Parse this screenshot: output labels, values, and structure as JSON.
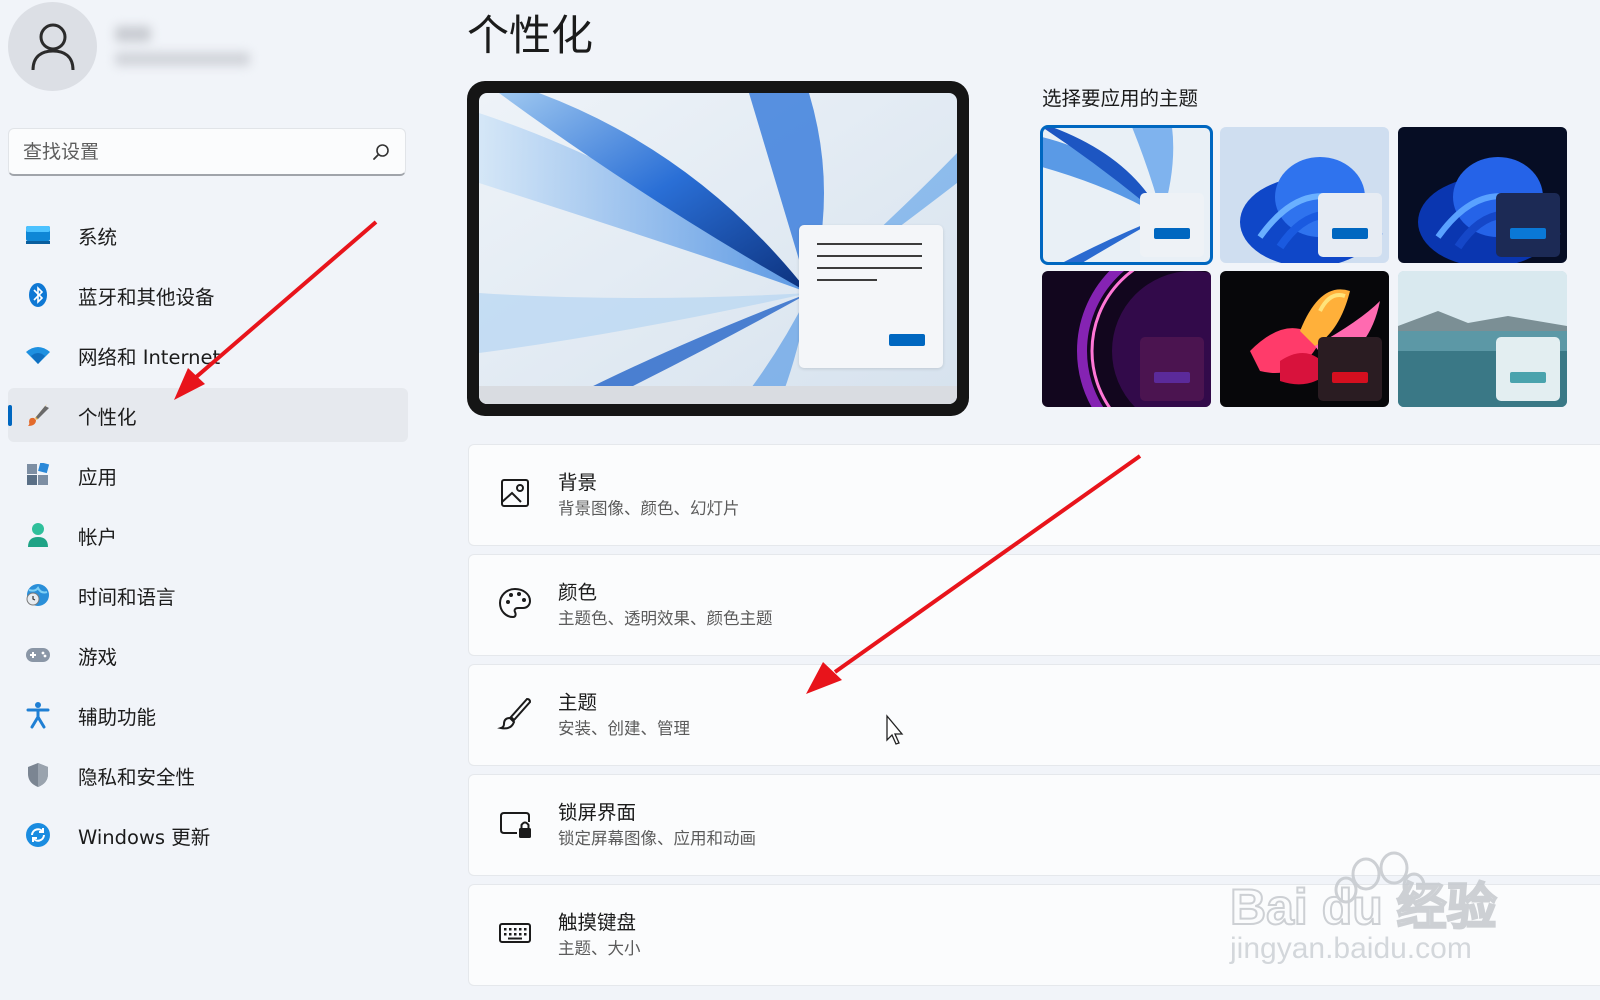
{
  "sidebar": {
    "search_placeholder": "查找设置",
    "items": [
      {
        "label": "系统",
        "icon": "system-icon"
      },
      {
        "label": "蓝牙和其他设备",
        "icon": "bluetooth-icon"
      },
      {
        "label": "网络和 Internet",
        "icon": "wifi-icon"
      },
      {
        "label": "个性化",
        "icon": "brush-icon",
        "active": true
      },
      {
        "label": "应用",
        "icon": "apps-icon"
      },
      {
        "label": "帐户",
        "icon": "account-icon"
      },
      {
        "label": "时间和语言",
        "icon": "time-language-icon"
      },
      {
        "label": "游戏",
        "icon": "gamepad-icon"
      },
      {
        "label": "辅助功能",
        "icon": "accessibility-icon"
      },
      {
        "label": "隐私和安全性",
        "icon": "shield-icon"
      },
      {
        "label": "Windows 更新",
        "icon": "update-icon"
      }
    ]
  },
  "main": {
    "title": "个性化",
    "themes_label": "选择要应用的主题",
    "cards": [
      {
        "title": "背景",
        "subtitle": "背景图像、颜色、幻灯片",
        "icon": "image-icon"
      },
      {
        "title": "颜色",
        "subtitle": "主题色、透明效果、颜色主题",
        "icon": "palette-icon"
      },
      {
        "title": "主题",
        "subtitle": "安装、创建、管理",
        "icon": "brush-icon"
      },
      {
        "title": "锁屏界面",
        "subtitle": "锁定屏幕图像、应用和动画",
        "icon": "lock-screen-icon"
      },
      {
        "title": "触摸键盘",
        "subtitle": "主题、大小",
        "icon": "keyboard-icon"
      }
    ]
  },
  "watermark": {
    "brand": "Bai du 经验",
    "url": "jingyan.baidu.com"
  },
  "colors": {
    "accent": "#0067c0",
    "arrow": "#e8141b"
  }
}
